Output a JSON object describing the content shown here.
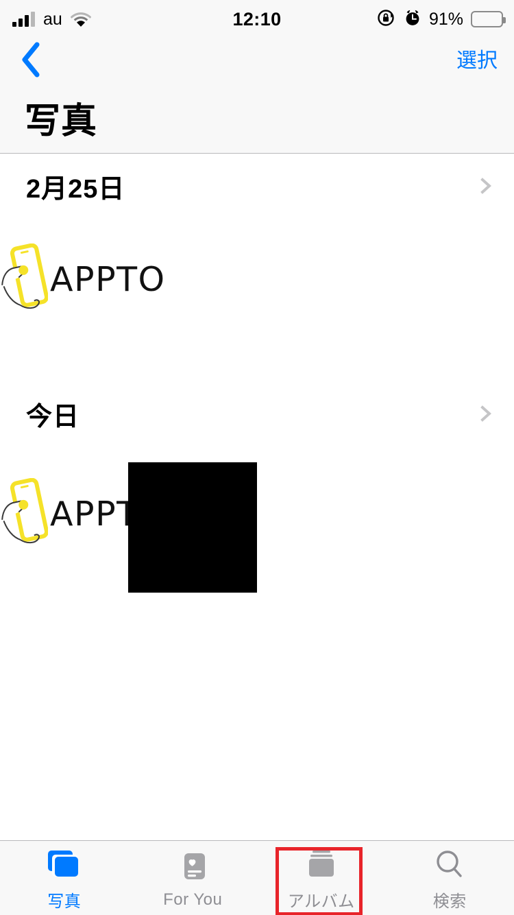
{
  "status_bar": {
    "carrier": "au",
    "time": "12:10",
    "battery_percent": "91%",
    "signal_icon": "cellular-signal-icon",
    "wifi_icon": "wifi-icon",
    "rotation_lock_icon": "rotation-lock-icon",
    "alarm_icon": "alarm-clock-icon",
    "battery_icon": "battery-icon"
  },
  "nav_bar": {
    "back_icon": "chevron-left-icon",
    "select_label": "選択",
    "title": "写真"
  },
  "sections": [
    {
      "title": "2月25日",
      "chevron_icon": "chevron-right-icon",
      "items": [
        {
          "type": "logo",
          "label": "APPTO"
        }
      ]
    },
    {
      "title": "今日",
      "chevron_icon": "chevron-right-icon",
      "items": [
        {
          "type": "logo",
          "label": "APPTO"
        },
        {
          "type": "photo",
          "label": "black-photo-thumbnail"
        }
      ]
    }
  ],
  "tab_bar": {
    "tabs": [
      {
        "label": "写真",
        "icon": "photos-stack-icon",
        "active": true
      },
      {
        "label": "For You",
        "icon": "for-you-card-icon",
        "active": false
      },
      {
        "label": "アルバム",
        "icon": "albums-stack-icon",
        "active": false
      },
      {
        "label": "検索",
        "icon": "magnifier-icon",
        "active": false
      }
    ],
    "highlighted_tab": "アルバム"
  },
  "colors": {
    "accent_blue": "#007aff",
    "inactive_gray": "#8e8e93",
    "highlight_red": "#e8242a",
    "bar_background": "#f8f8f8",
    "logo_yellow": "#f5e229"
  }
}
